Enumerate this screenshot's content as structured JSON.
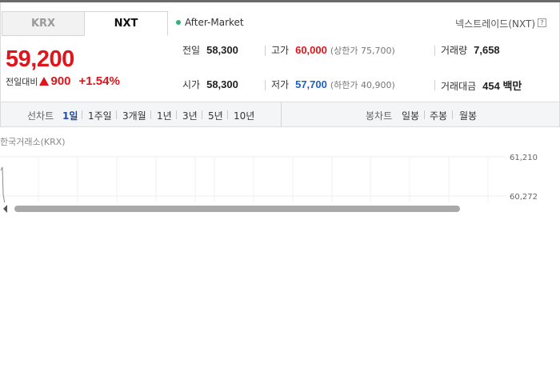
{
  "tabs": {
    "krx": "KRX",
    "nxt": "NXT"
  },
  "session": {
    "label": "After-Market",
    "dot_color": "#2fb57a"
  },
  "market": {
    "name": "넥스트레이드(NXT)",
    "help": "?"
  },
  "quote": {
    "price": "59,200",
    "change_label": "전일대비",
    "change_amount": "900",
    "change_percent": "+1.54%",
    "up_color": "#e0141a",
    "down_color": "#1a5fcc"
  },
  "stats": {
    "prev_close": {
      "label": "전일",
      "value": "58,300"
    },
    "high": {
      "label": "고가",
      "value": "60,000",
      "sub": "(상한가 75,700)"
    },
    "volume": {
      "label": "거래량",
      "value": "7,658"
    },
    "open": {
      "label": "시가",
      "value": "58,300"
    },
    "low": {
      "label": "저가",
      "value": "57,700",
      "sub": "(하한가 40,900)"
    },
    "amount": {
      "label": "거래대금",
      "value": "454 백만"
    }
  },
  "line_chart_controls": {
    "label": "선차트",
    "periods": [
      "1일",
      "1주일",
      "3개월",
      "1년",
      "3년",
      "5년",
      "10년"
    ],
    "selected": "1일"
  },
  "candle_chart_controls": {
    "label": "봉차트",
    "periods": [
      "일봉",
      "주봉",
      "월봉"
    ]
  },
  "chart": {
    "title": "한국거래소(KRX)",
    "y_ticks": [
      "61,210",
      "60,272"
    ]
  }
}
